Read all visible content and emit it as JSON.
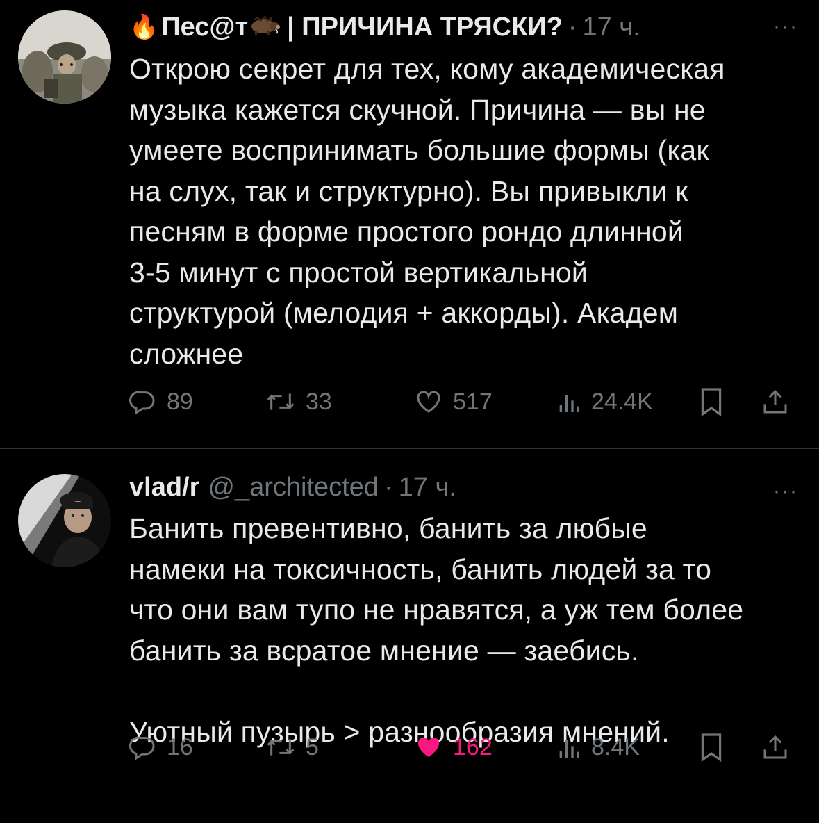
{
  "tweets": [
    {
      "display_name": "Пес@т",
      "name_prefix_emoji": "🔥",
      "name_suffix_icon": "boar-icon",
      "name_rest": "| ПРИЧИНА ТРЯСКИ?",
      "handle": "",
      "time_sep": "·",
      "time": "17 ч.",
      "more": "···",
      "text": "Открою секрет для тех, кому академическая\nмузыка кажется скучной. Причина — вы не\nумеете воспринимать большие формы (как\nна слух, так и структурно). Вы привыкли к\nпесням в форме простого рондо длинной\n3-5 минут с простой вертикальной\nструктурой (мелодия + аккорды). Академ\nсложнее",
      "replies": "89",
      "retweets": "33",
      "likes": "517",
      "liked": false,
      "views": "24.4K"
    },
    {
      "display_name": "vlad/r",
      "handle": "@_architected",
      "time_sep": "·",
      "time": "17 ч.",
      "more": "···",
      "text": "Банить превентивно, банить за любые\nнамеки на токсичность, банить людей за то\nчто они вам тупо не нравятся, а уж тем более\nбанить за всратое мнение — заебись.\n\nУютный пузырь > разнообразия мнений.",
      "replies": "16",
      "retweets": "5",
      "likes": "162",
      "liked": true,
      "like_color": "#f91880",
      "views": "8.4K"
    }
  ],
  "colors": {
    "background": "#000000",
    "text": "#e7e9ea",
    "muted": "#71767b",
    "divider": "#2f3336",
    "like_active": "#f91880"
  }
}
